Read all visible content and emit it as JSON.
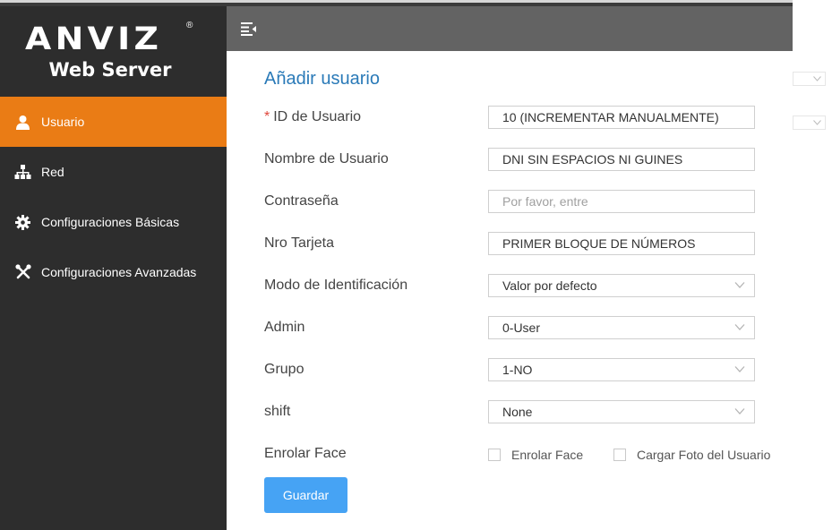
{
  "app": {
    "logo_word": "ANVIZ",
    "logo_registered": "®",
    "logo_subtitle": "Web Server"
  },
  "sidebar": {
    "items": [
      {
        "label": "Usuario",
        "icon": "user-icon",
        "active": true
      },
      {
        "label": "Red",
        "icon": "network-icon",
        "active": false
      },
      {
        "label": "Configuraciones Básicas",
        "icon": "gear-icon",
        "active": false
      },
      {
        "label": "Configuraciones Avanzadas",
        "icon": "tools-icon",
        "active": false
      }
    ]
  },
  "header": {
    "menu_icon": "menu-collapse-icon"
  },
  "form": {
    "title": "Añadir usuario",
    "required_mark": "*",
    "fields": {
      "user_id": {
        "label": "ID de Usuario",
        "value": "10 (INCREMENTAR MANUALMENTE)"
      },
      "user_name": {
        "label": "Nombre de Usuario",
        "value": "DNI SIN ESPACIOS NI GUINES"
      },
      "password": {
        "label": "Contraseña",
        "value": "",
        "placeholder": "Por favor, entre"
      },
      "card_no": {
        "label": "Nro Tarjeta",
        "value": "PRIMER BLOQUE DE NÚMEROS"
      },
      "id_mode": {
        "label": "Modo de Identificación",
        "value": "Valor por defecto"
      },
      "admin": {
        "label": "Admin",
        "value": "0-User"
      },
      "group": {
        "label": "Grupo",
        "value": "1-NO"
      },
      "shift": {
        "label": "shift",
        "value": "None"
      }
    },
    "enroll": {
      "label": "Enrolar Face",
      "option_face": "Enrolar Face",
      "option_photo": "Cargar Foto del Usuario"
    },
    "save_label": "Guardar"
  },
  "colors": {
    "sidebar_bg": "#2d2d2d",
    "active_item": "#ea7c15",
    "header_bg": "#636363",
    "title": "#2a7ab8",
    "button": "#46a3f4",
    "required": "#e0463b"
  }
}
